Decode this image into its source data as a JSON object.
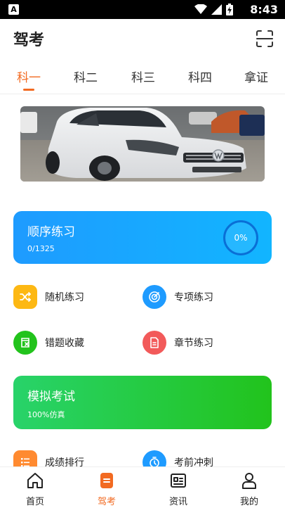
{
  "status_bar": {
    "time": "8:43",
    "notification_icon": "A"
  },
  "header": {
    "title": "驾考",
    "scan_icon": "scan-icon"
  },
  "tabs": [
    {
      "label": "科一",
      "active": true
    },
    {
      "label": "科二",
      "active": false
    },
    {
      "label": "科三",
      "active": false
    },
    {
      "label": "科四",
      "active": false
    },
    {
      "label": "拿证",
      "active": false
    }
  ],
  "sequential_practice": {
    "title": "顺序练习",
    "progress": "0/1325",
    "percent": "0%"
  },
  "menu_row1": [
    {
      "label": "随机练习",
      "icon": "shuffle-icon",
      "color": "#fdb813"
    },
    {
      "label": "专项练习",
      "icon": "target-icon",
      "color": "#1e9bff"
    }
  ],
  "menu_row2": [
    {
      "label": "错题收藏",
      "icon": "bookmark-x-icon",
      "color": "#22c31c"
    },
    {
      "label": "章节练习",
      "icon": "document-icon",
      "color": "#f25a5a"
    }
  ],
  "mock_exam": {
    "title": "模拟考试",
    "subtitle": "100%仿真"
  },
  "menu_row3": [
    {
      "label": "成绩排行",
      "icon": "list-icon",
      "color": "#ff8a30"
    },
    {
      "label": "考前冲刺",
      "icon": "stopwatch-icon",
      "color": "#1e9bff"
    }
  ],
  "bottom_nav": [
    {
      "label": "首页",
      "icon": "home-icon",
      "active": false
    },
    {
      "label": "驾考",
      "icon": "exam-doc-icon",
      "active": true
    },
    {
      "label": "资讯",
      "icon": "news-icon",
      "active": false
    },
    {
      "label": "我的",
      "icon": "profile-icon",
      "active": false
    }
  ],
  "colors": {
    "accent": "#f26a21",
    "blue": "#1e9bff",
    "green": "#22c31c"
  }
}
